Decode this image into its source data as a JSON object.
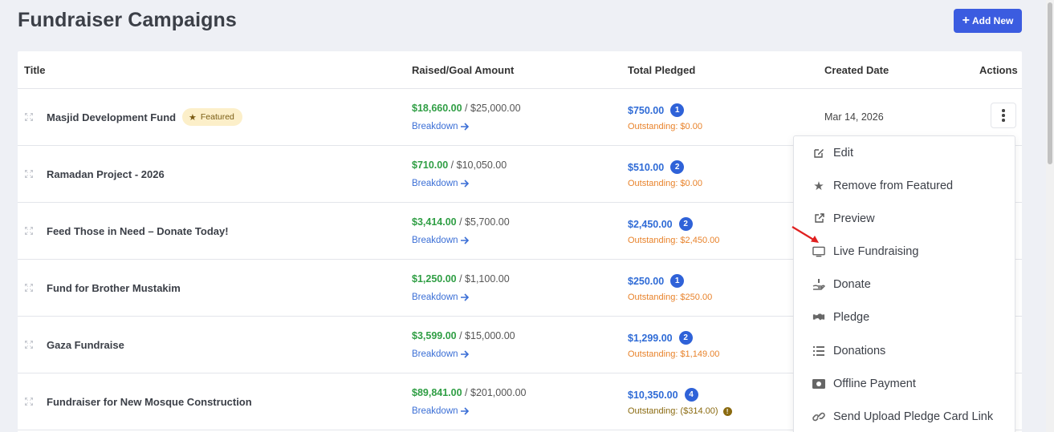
{
  "page": {
    "title": "Fundraiser Campaigns",
    "add_new_label": "Add New"
  },
  "table": {
    "headers": {
      "title": "Title",
      "raised_goal": "Raised/Goal Amount",
      "total_pledged": "Total Pledged",
      "created_date": "Created Date",
      "actions": "Actions"
    },
    "breakdown_label": "Breakdown",
    "rows": [
      {
        "title": "Masjid Development Fund",
        "featured": "Featured",
        "raised": "$18,660.00",
        "goal": "/ $25,000.00",
        "pledged": "$750.00",
        "pledge_count": "1",
        "outstanding": "Outstanding: $0.00",
        "created": "Mar 14, 2026"
      },
      {
        "title": "Ramadan Project - 2026",
        "raised": "$710.00",
        "goal": "/ $10,050.00",
        "pledged": "$510.00",
        "pledge_count": "2",
        "outstanding": "Outstanding: $0.00"
      },
      {
        "title": "Feed Those in Need – Donate Today!",
        "raised": "$3,414.00",
        "goal": "/ $5,700.00",
        "pledged": "$2,450.00",
        "pledge_count": "2",
        "outstanding": "Outstanding: $2,450.00"
      },
      {
        "title": "Fund for Brother Mustakim",
        "raised": "$1,250.00",
        "goal": "/ $1,100.00",
        "pledged": "$250.00",
        "pledge_count": "1",
        "outstanding": "Outstanding: $250.00"
      },
      {
        "title": "Gaza Fundraise",
        "raised": "$3,599.00",
        "goal": "/ $15,000.00",
        "pledged": "$1,299.00",
        "pledge_count": "2",
        "outstanding": "Outstanding: $1,149.00"
      },
      {
        "title": "Fundraiser for New Mosque Construction",
        "raised": "$89,841.00",
        "goal": "/ $201,000.00",
        "pledged": "$10,350.00",
        "pledge_count": "4",
        "outstanding": "Outstanding: ($314.00)"
      }
    ]
  },
  "actions_menu": {
    "items": [
      {
        "label": "Edit",
        "icon": "edit-icon"
      },
      {
        "label": "Remove from Featured",
        "icon": "star-icon"
      },
      {
        "label": "Preview",
        "icon": "external-link-icon"
      },
      {
        "label": "Live Fundraising",
        "icon": "monitor-icon"
      },
      {
        "label": "Donate",
        "icon": "hand-donate-icon"
      },
      {
        "label": "Pledge",
        "icon": "handshake-icon"
      },
      {
        "label": "Donations",
        "icon": "list-icon"
      },
      {
        "label": "Offline Payment",
        "icon": "money-bill-icon"
      },
      {
        "label": "Send Upload Pledge Card Link",
        "icon": "link-icon"
      }
    ]
  },
  "colors": {
    "primary": "#3b5ce0",
    "raised_green": "#2f9e44",
    "pledged_blue": "#2f6bd6",
    "outstanding_orange": "#e8822a",
    "annotation_arrow": "#e02020"
  }
}
